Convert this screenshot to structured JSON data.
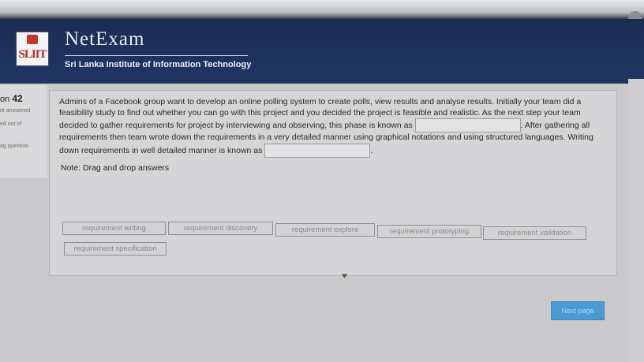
{
  "header": {
    "logo_text": "SLIIT",
    "brand": "NetExam",
    "tagline": "Sri Lanka Institute of Information Technology"
  },
  "sidebar": {
    "question_prefix": "on",
    "question_number": "42",
    "status_answered": "ot answered",
    "marked_out_of": "ed out of",
    "flag_question": "ag question"
  },
  "question": {
    "part1": "Admins of a Facebook group want to develop an online polling system to create polls, view results and analyse results. Initially your team did a feasibility study to find out whether you can go with this project and you decided the project is feasible and realistic. As the next step your team decided to gather requirements for project by interviewing and observing, this phase is known as",
    "part2": ". After gathering all requirements then team wrote down the requirements in a very detailed manner using graphical notations and using structured languages. Writing down requirements in well detailed manner is known as",
    "part3": ".",
    "note": "Note: Drag and drop answers"
  },
  "answers": [
    "requirement writing",
    "requirement discovery",
    "requirement explore",
    "requirement prototyping",
    "requirement validation",
    "requirement specification"
  ],
  "next_button": "Next page"
}
